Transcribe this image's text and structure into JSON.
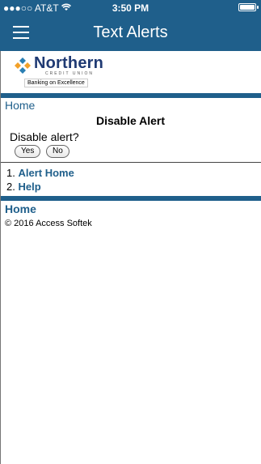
{
  "statusbar": {
    "carrier": "●●●○○ AT&T",
    "wifi_icon": "wifi-icon",
    "time": "3:50 PM"
  },
  "navbar": {
    "title": "Text Alerts",
    "menu_icon": "hamburger-menu-icon"
  },
  "logo": {
    "name": "Northern",
    "sub": "CREDIT UNION",
    "tagline": "Banking on Excellence"
  },
  "page": {
    "breadcrumb_home": "Home",
    "section_title": "Disable Alert",
    "question": "Disable alert?",
    "buttons": {
      "yes": "Yes",
      "no": "No"
    },
    "menu": [
      {
        "number": "1.",
        "label": "Alert Home"
      },
      {
        "number": "2.",
        "label": "Help"
      }
    ],
    "footer_home": "Home",
    "copyright": "© 2016 Access Softek"
  },
  "colors": {
    "brand": "#1f5f8b",
    "logo_text": "#1f3a73"
  }
}
